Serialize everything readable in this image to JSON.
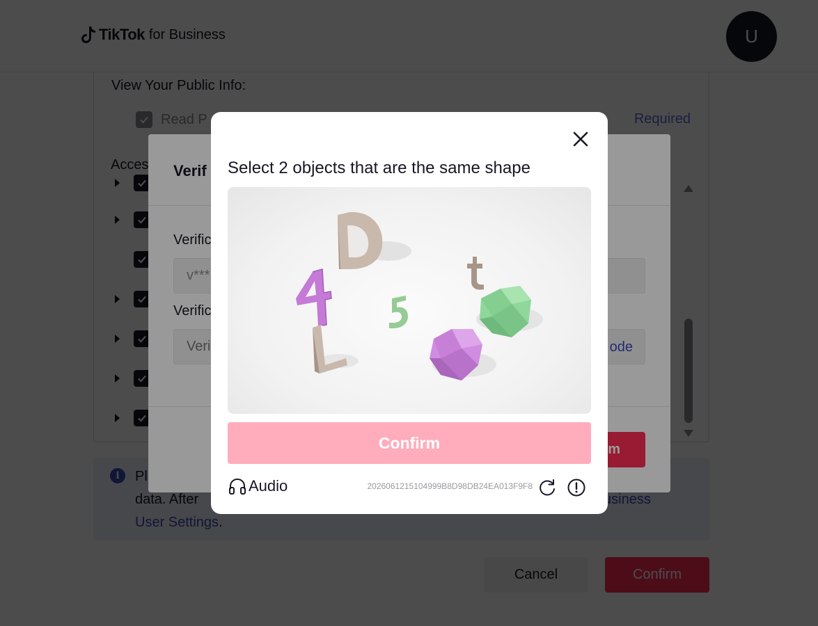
{
  "header": {
    "brand": "TikTok",
    "brand_sub": "for Business",
    "avatar_letter": "U"
  },
  "permissions": {
    "public_info_title": "View Your Public Info:",
    "read_profile_label": "Read P",
    "required_label": "Required",
    "access_title": "Acces"
  },
  "info": {
    "line1_start": "Pl",
    "line2_start": "data. After",
    "link_part1": "usiness",
    "link_part2": "User Settings",
    "suffix": "."
  },
  "footer": {
    "cancel_label": "Cancel",
    "confirm_label": "Confirm"
  },
  "verify_modal": {
    "title": "Verif",
    "field1_label": "Verific",
    "field1_value": "v***",
    "field2_label": "Verific",
    "field2_placeholder": "Veri",
    "send_code_label": "ode",
    "confirm_label": "m"
  },
  "captcha": {
    "title": "Select 2 objects that are the same shape",
    "confirm_label": "Confirm",
    "audio_label": "Audio",
    "request_id": "2026061215104999B8D98DB24EA013F9F8",
    "image_letters": [
      "D",
      "t",
      "4",
      "5",
      "L"
    ]
  },
  "colors": {
    "brand_red": "#fe2c55",
    "confirm_disabled": "#ffadbd",
    "link_blue": "#3b4ab8",
    "shape_purple": "#d08ce0",
    "shape_green": "#8fd79a",
    "letter_beige": "#c9b8ac"
  },
  "icons": {
    "close": "close-icon",
    "audio": "headphones-icon",
    "refresh": "refresh-icon",
    "report": "exclamation-circle-icon",
    "info": "info-icon"
  }
}
